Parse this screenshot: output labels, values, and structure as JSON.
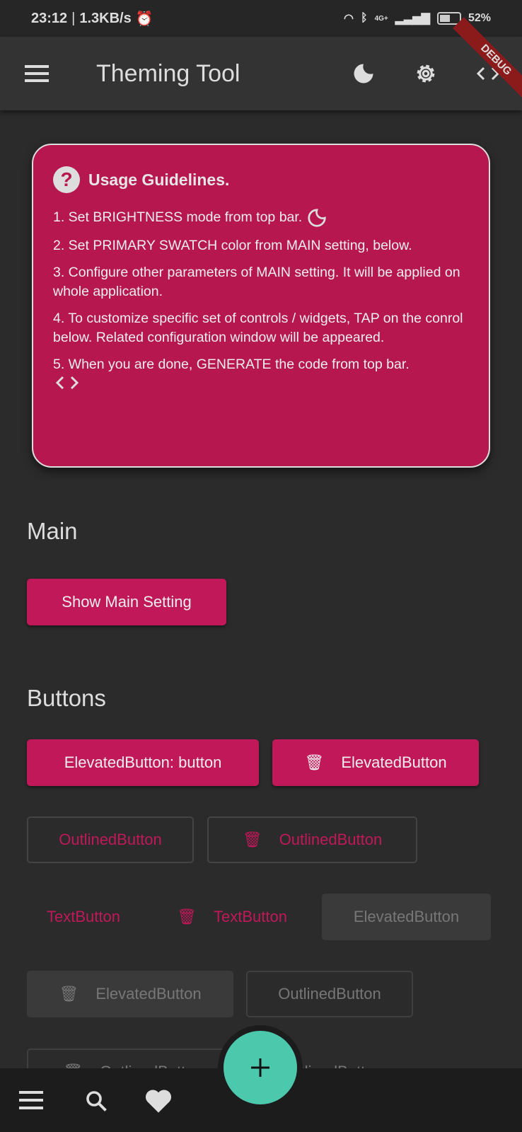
{
  "status_bar": {
    "time": "23:12",
    "speed": "1.3KB/s",
    "network": "4G+",
    "battery": "52%"
  },
  "app_bar": {
    "title": "Theming Tool",
    "debug_banner": "DEBUG"
  },
  "guidelines": {
    "title": "Usage Guidelines.",
    "items": [
      "1.  Set BRIGHTNESS mode from top bar.",
      "2.  Set PRIMARY SWATCH color from MAIN setting, below.",
      "3.  Configure other parameters of MAIN setting. It will be applied on whole application.",
      "4.  To customize specific set of controls / widgets, TAP on the conrol below. Related configuration window will be appeared.",
      "5.  When you are done, GENERATE the code from top bar."
    ]
  },
  "main": {
    "heading": "Main",
    "button": "Show Main Setting"
  },
  "buttons": {
    "heading": "Buttons",
    "elevated_label": "ElevatedButton: button",
    "elevated_icon": "ElevatedButton",
    "outlined": "OutlinedButton",
    "outlined_icon": "OutlinedButton",
    "text": "TextButton",
    "text_icon": "TextButton",
    "disabled_elevated": "ElevatedButton",
    "disabled_elevated_icon": "ElevatedButton",
    "disabled_outlined": "OutlinedButton",
    "disabled_outlined_icon": "OutlinedButton",
    "disabled_outlined_2": "OutlinedButton"
  },
  "colors": {
    "primary": "#c1185a",
    "card": "#b5174e",
    "fab": "#4cc9ad",
    "background": "#2b2b2b"
  }
}
